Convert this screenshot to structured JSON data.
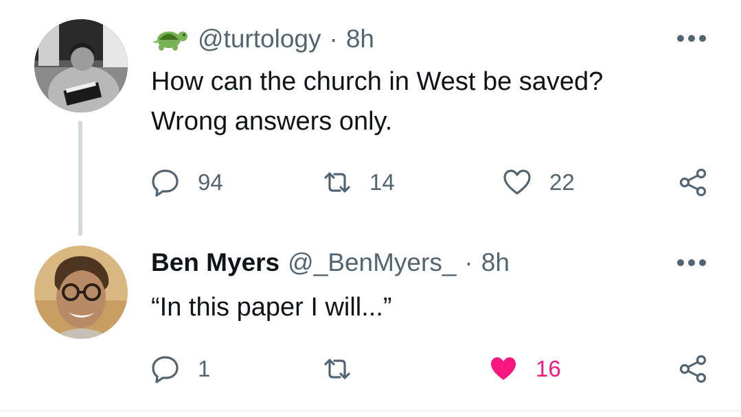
{
  "colors": {
    "text_primary": "#0f1419",
    "text_secondary": "#536471",
    "like_active": "#f91880",
    "thread_line": "#cfd9de"
  },
  "tweets": [
    {
      "avatar_icon": "user-avatar-reading-man",
      "badge_icon": "turtle-emoji-icon",
      "display_name": "",
      "handle": "@turtology",
      "separator": "·",
      "time": "8h",
      "text_lines": [
        "How can the church in West be saved?",
        "Wrong answers only."
      ],
      "actions": {
        "reply": {
          "icon": "reply-icon",
          "count": "94"
        },
        "retweet": {
          "icon": "retweet-icon",
          "count": "14"
        },
        "like": {
          "icon": "heart-outline-icon",
          "count": "22",
          "liked": false
        },
        "share": {
          "icon": "share-icon"
        }
      },
      "more_icon": "more-options-icon"
    },
    {
      "avatar_icon": "user-avatar-smiling-man-glasses",
      "display_name": "Ben Myers",
      "handle": "@_BenMyers_",
      "separator": "·",
      "time": "8h",
      "text_lines": [
        "“In this paper I will...”"
      ],
      "actions": {
        "reply": {
          "icon": "reply-icon",
          "count": "1"
        },
        "retweet": {
          "icon": "retweet-icon",
          "count": ""
        },
        "like": {
          "icon": "heart-filled-icon",
          "count": "16",
          "liked": true
        },
        "share": {
          "icon": "share-icon"
        }
      },
      "more_icon": "more-options-icon"
    }
  ]
}
